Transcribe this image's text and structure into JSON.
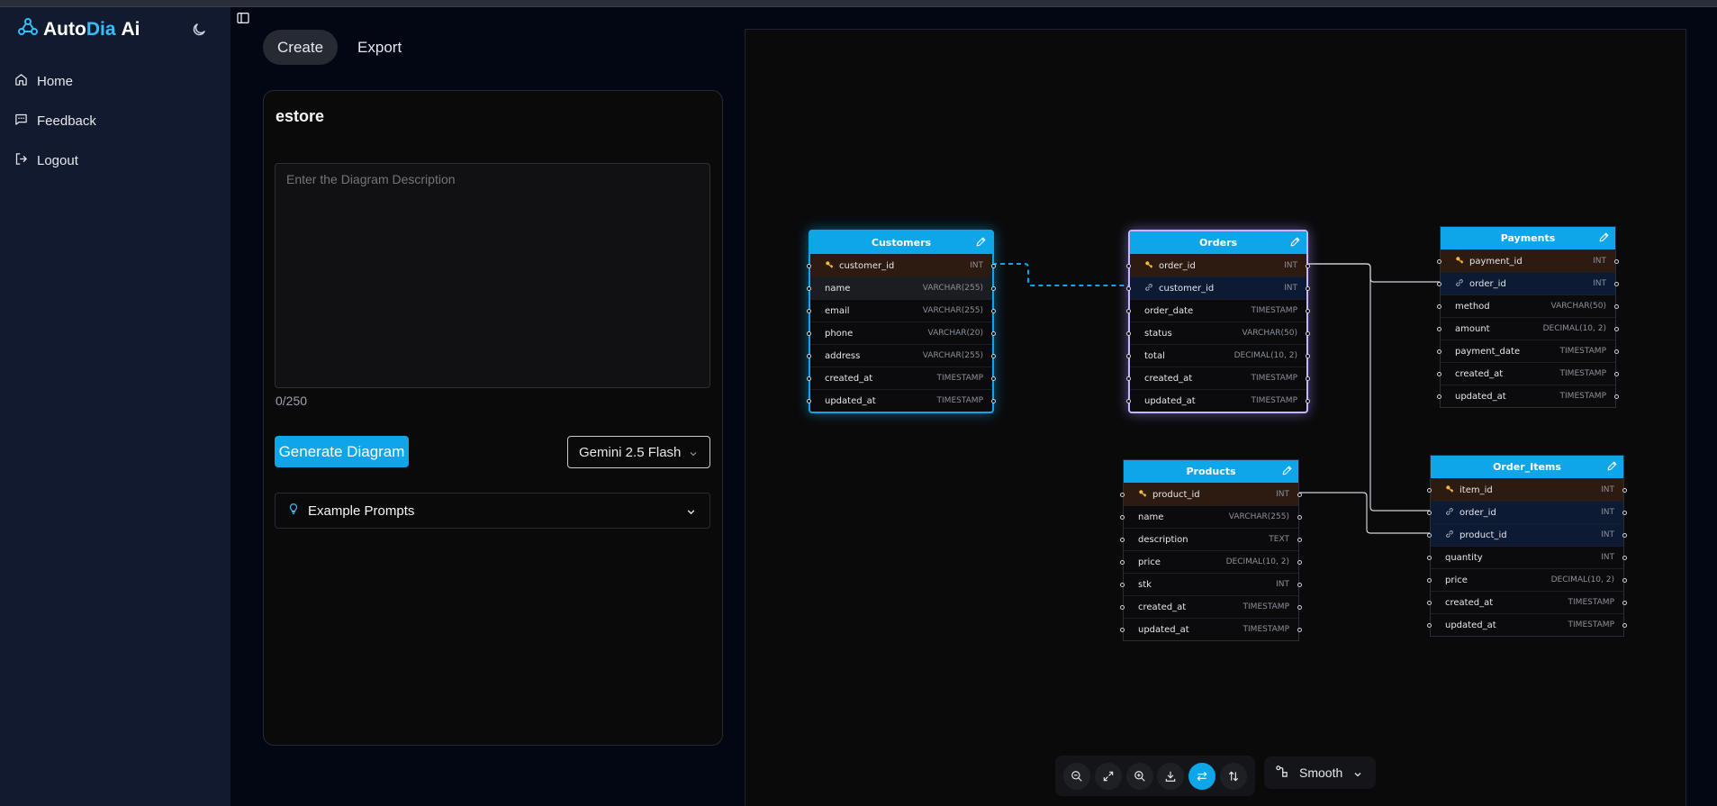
{
  "brand": {
    "part1": "Auto",
    "part2": "Dia",
    "part3": "Ai"
  },
  "nav": [
    {
      "label": "Home",
      "icon": "home-icon"
    },
    {
      "label": "Feedback",
      "icon": "feedback-icon"
    },
    {
      "label": "Logout",
      "icon": "logout-icon"
    }
  ],
  "tabs": {
    "create": "Create",
    "export": "Export",
    "active": "Create"
  },
  "editor": {
    "title": "estore",
    "description_placeholder": "Enter the Diagram Description",
    "description_value": "",
    "counter": "0/250",
    "generate_label": "Generate Diagram",
    "model": "Gemini 2.5 Flash",
    "examples_label": "Example Prompts"
  },
  "diagram": {
    "tables": [
      {
        "name": "Customers",
        "columns": [
          {
            "name": "customer_id",
            "type": "INT",
            "key": "pk"
          },
          {
            "name": "name",
            "type": "VARCHAR(255)",
            "key": ""
          },
          {
            "name": "email",
            "type": "VARCHAR(255)",
            "key": ""
          },
          {
            "name": "phone",
            "type": "VARCHAR(20)",
            "key": ""
          },
          {
            "name": "address",
            "type": "VARCHAR(255)",
            "key": ""
          },
          {
            "name": "created_at",
            "type": "TIMESTAMP",
            "key": ""
          },
          {
            "name": "updated_at",
            "type": "TIMESTAMP",
            "key": ""
          }
        ]
      },
      {
        "name": "Orders",
        "columns": [
          {
            "name": "order_id",
            "type": "INT",
            "key": "pk"
          },
          {
            "name": "customer_id",
            "type": "INT",
            "key": "fk"
          },
          {
            "name": "order_date",
            "type": "TIMESTAMP",
            "key": ""
          },
          {
            "name": "status",
            "type": "VARCHAR(50)",
            "key": ""
          },
          {
            "name": "total",
            "type": "DECIMAL(10, 2)",
            "key": ""
          },
          {
            "name": "created_at",
            "type": "TIMESTAMP",
            "key": ""
          },
          {
            "name": "updated_at",
            "type": "TIMESTAMP",
            "key": ""
          }
        ]
      },
      {
        "name": "Payments",
        "columns": [
          {
            "name": "payment_id",
            "type": "INT",
            "key": "pk"
          },
          {
            "name": "order_id",
            "type": "INT",
            "key": "fk"
          },
          {
            "name": "method",
            "type": "VARCHAR(50)",
            "key": ""
          },
          {
            "name": "amount",
            "type": "DECIMAL(10, 2)",
            "key": ""
          },
          {
            "name": "payment_date",
            "type": "TIMESTAMP",
            "key": ""
          },
          {
            "name": "created_at",
            "type": "TIMESTAMP",
            "key": ""
          },
          {
            "name": "updated_at",
            "type": "TIMESTAMP",
            "key": ""
          }
        ]
      },
      {
        "name": "Products",
        "columns": [
          {
            "name": "product_id",
            "type": "INT",
            "key": "pk"
          },
          {
            "name": "name",
            "type": "VARCHAR(255)",
            "key": ""
          },
          {
            "name": "description",
            "type": "TEXT",
            "key": ""
          },
          {
            "name": "price",
            "type": "DECIMAL(10, 2)",
            "key": ""
          },
          {
            "name": "stk",
            "type": "INT",
            "key": ""
          },
          {
            "name": "created_at",
            "type": "TIMESTAMP",
            "key": ""
          },
          {
            "name": "updated_at",
            "type": "TIMESTAMP",
            "key": ""
          }
        ]
      },
      {
        "name": "Order_Items",
        "columns": [
          {
            "name": "item_id",
            "type": "INT",
            "key": "pk"
          },
          {
            "name": "order_id",
            "type": "INT",
            "key": "fk"
          },
          {
            "name": "product_id",
            "type": "INT",
            "key": "fk"
          },
          {
            "name": "quantity",
            "type": "INT",
            "key": ""
          },
          {
            "name": "price",
            "type": "DECIMAL(10, 2)",
            "key": ""
          },
          {
            "name": "created_at",
            "type": "TIMESTAMP",
            "key": ""
          },
          {
            "name": "updated_at",
            "type": "TIMESTAMP",
            "key": ""
          }
        ]
      }
    ]
  },
  "toolbar": {
    "buttons": [
      "zoom-out-icon",
      "fit-view-icon",
      "zoom-in-icon",
      "download-icon",
      "horizontal-layout-icon",
      "vertical-layout-icon"
    ],
    "active_button": "horizontal-layout-icon",
    "edge_style": "Smooth"
  },
  "colors": {
    "accent": "#0ea5e9",
    "sidebar_bg": "#111a2e",
    "page_bg": "#030713",
    "pk_row": "#2d1a10",
    "fk_row": "#0c1a33",
    "selected_purple": "#c4b5fd"
  }
}
